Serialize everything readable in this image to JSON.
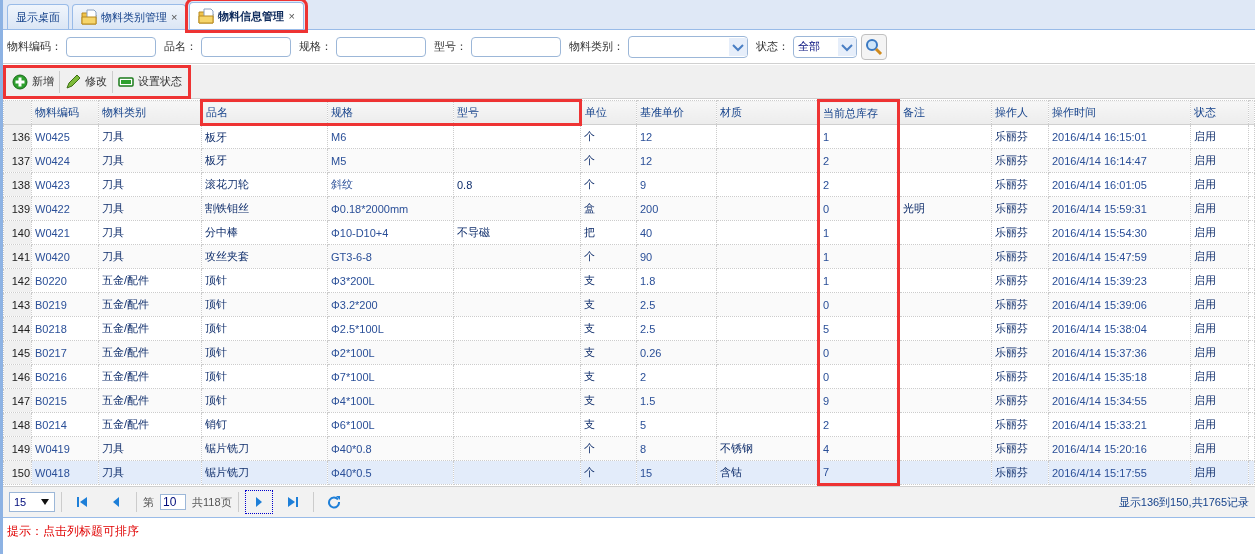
{
  "tabs": [
    {
      "label": "显示桌面",
      "icon": false,
      "closable": false,
      "selected": false,
      "highlighted": false
    },
    {
      "label": "物料类别管理",
      "icon": true,
      "closable": true,
      "selected": false,
      "highlighted": false
    },
    {
      "label": "物料信息管理",
      "icon": true,
      "closable": true,
      "selected": true,
      "highlighted": true
    }
  ],
  "close_glyph": "×",
  "search": {
    "fields": [
      {
        "label": "物料编码：",
        "kind": "text"
      },
      {
        "label": "品名：",
        "kind": "text"
      },
      {
        "label": "规格：",
        "kind": "text"
      },
      {
        "label": "型号：",
        "kind": "text"
      },
      {
        "label": "物料类别：",
        "kind": "combo"
      },
      {
        "label": "状态：",
        "kind": "select",
        "value": "全部"
      }
    ]
  },
  "toolbar": {
    "highlighted": true,
    "buttons": [
      {
        "label": "新增",
        "kind": "add"
      },
      {
        "label": "修改",
        "kind": "edit"
      },
      {
        "label": "设置状态",
        "kind": "status"
      }
    ]
  },
  "table": {
    "columns": [
      {
        "label": "物料编码"
      },
      {
        "label": "物料类别"
      },
      {
        "label": "品名",
        "header_highlighted": true
      },
      {
        "label": "规格",
        "header_highlighted": true
      },
      {
        "label": "型号",
        "header_highlighted": true
      },
      {
        "label": "单位"
      },
      {
        "label": "基准单价"
      },
      {
        "label": "材质"
      },
      {
        "label": "当前总库存",
        "column_highlighted": true
      },
      {
        "label": "备注"
      },
      {
        "label": "操作人"
      },
      {
        "label": "操作时间"
      },
      {
        "label": "状态"
      }
    ],
    "rows": [
      {
        "number": "136",
        "selected": false,
        "cells": [
          "W0425",
          "刀具",
          "板牙",
          "M6",
          "",
          "个",
          "12",
          "",
          "1",
          "",
          "乐丽芬",
          "2016/4/14 16:15:01",
          "启用"
        ]
      },
      {
        "number": "137",
        "selected": false,
        "cells": [
          "W0424",
          "刀具",
          "板牙",
          "M5",
          "",
          "个",
          "12",
          "",
          "2",
          "",
          "乐丽芬",
          "2016/4/14 16:14:47",
          "启用"
        ]
      },
      {
        "number": "138",
        "selected": false,
        "cells": [
          "W0423",
          "刀具",
          "滚花刀轮",
          "斜纹",
          "0.8",
          "个",
          "9",
          "",
          "2",
          "",
          "乐丽芬",
          "2016/4/14 16:01:05",
          "启用"
        ]
      },
      {
        "number": "139",
        "selected": false,
        "cells": [
          "W0422",
          "刀具",
          "割铁钼丝",
          "Φ0.18*2000mm",
          "",
          "盒",
          "200",
          "",
          "0",
          "光明",
          "乐丽芬",
          "2016/4/14 15:59:31",
          "启用"
        ]
      },
      {
        "number": "140",
        "selected": false,
        "cells": [
          "W0421",
          "刀具",
          "分中棒",
          "Φ10-D10+4",
          "不导磁",
          "把",
          "40",
          "",
          "1",
          "",
          "乐丽芬",
          "2016/4/14 15:54:30",
          "启用"
        ]
      },
      {
        "number": "141",
        "selected": false,
        "cells": [
          "W0420",
          "刀具",
          "攻丝夹套",
          "GT3-6-8",
          "",
          "个",
          "90",
          "",
          "1",
          "",
          "乐丽芬",
          "2016/4/14 15:47:59",
          "启用"
        ]
      },
      {
        "number": "142",
        "selected": false,
        "cells": [
          "B0220",
          "五金/配件",
          "顶针",
          "Φ3*200L",
          "",
          "支",
          "1.8",
          "",
          "1",
          "",
          "乐丽芬",
          "2016/4/14 15:39:23",
          "启用"
        ]
      },
      {
        "number": "143",
        "selected": false,
        "cells": [
          "B0219",
          "五金/配件",
          "顶针",
          "Φ3.2*200",
          "",
          "支",
          "2.5",
          "",
          "0",
          "",
          "乐丽芬",
          "2016/4/14 15:39:06",
          "启用"
        ]
      },
      {
        "number": "144",
        "selected": false,
        "cells": [
          "B0218",
          "五金/配件",
          "顶针",
          "Φ2.5*100L",
          "",
          "支",
          "2.5",
          "",
          "5",
          "",
          "乐丽芬",
          "2016/4/14 15:38:04",
          "启用"
        ]
      },
      {
        "number": "145",
        "selected": false,
        "cells": [
          "B0217",
          "五金/配件",
          "顶针",
          "Φ2*100L",
          "",
          "支",
          "0.26",
          "",
          "0",
          "",
          "乐丽芬",
          "2016/4/14 15:37:36",
          "启用"
        ]
      },
      {
        "number": "146",
        "selected": false,
        "cells": [
          "B0216",
          "五金/配件",
          "顶针",
          "Φ7*100L",
          "",
          "支",
          "2",
          "",
          "0",
          "",
          "乐丽芬",
          "2016/4/14 15:35:18",
          "启用"
        ]
      },
      {
        "number": "147",
        "selected": false,
        "cells": [
          "B0215",
          "五金/配件",
          "顶针",
          "Φ4*100L",
          "",
          "支",
          "1.5",
          "",
          "9",
          "",
          "乐丽芬",
          "2016/4/14 15:34:55",
          "启用"
        ]
      },
      {
        "number": "148",
        "selected": false,
        "cells": [
          "B0214",
          "五金/配件",
          "销钉",
          "Φ6*100L",
          "",
          "支",
          "5",
          "",
          "2",
          "",
          "乐丽芬",
          "2016/4/14 15:33:21",
          "启用"
        ]
      },
      {
        "number": "149",
        "selected": false,
        "cells": [
          "W0419",
          "刀具",
          "锯片铣刀",
          "Φ40*0.8",
          "",
          "个",
          "8",
          "不锈钢",
          "4",
          "",
          "乐丽芬",
          "2016/4/14 15:20:16",
          "启用"
        ]
      },
      {
        "number": "150",
        "selected": true,
        "cells": [
          "W0418",
          "刀具",
          "锯片铣刀",
          "Φ40*0.5",
          "",
          "个",
          "15",
          "含钴",
          "7",
          "",
          "乐丽芬",
          "2016/4/14 15:17:55",
          "启用"
        ]
      }
    ]
  },
  "pager": {
    "page_size": "15",
    "page_prefix": "第",
    "page": "10",
    "page_suffix": "共118页",
    "summary": "显示136到150,共1765记录"
  },
  "hint": "提示：点击列标题可排序"
}
